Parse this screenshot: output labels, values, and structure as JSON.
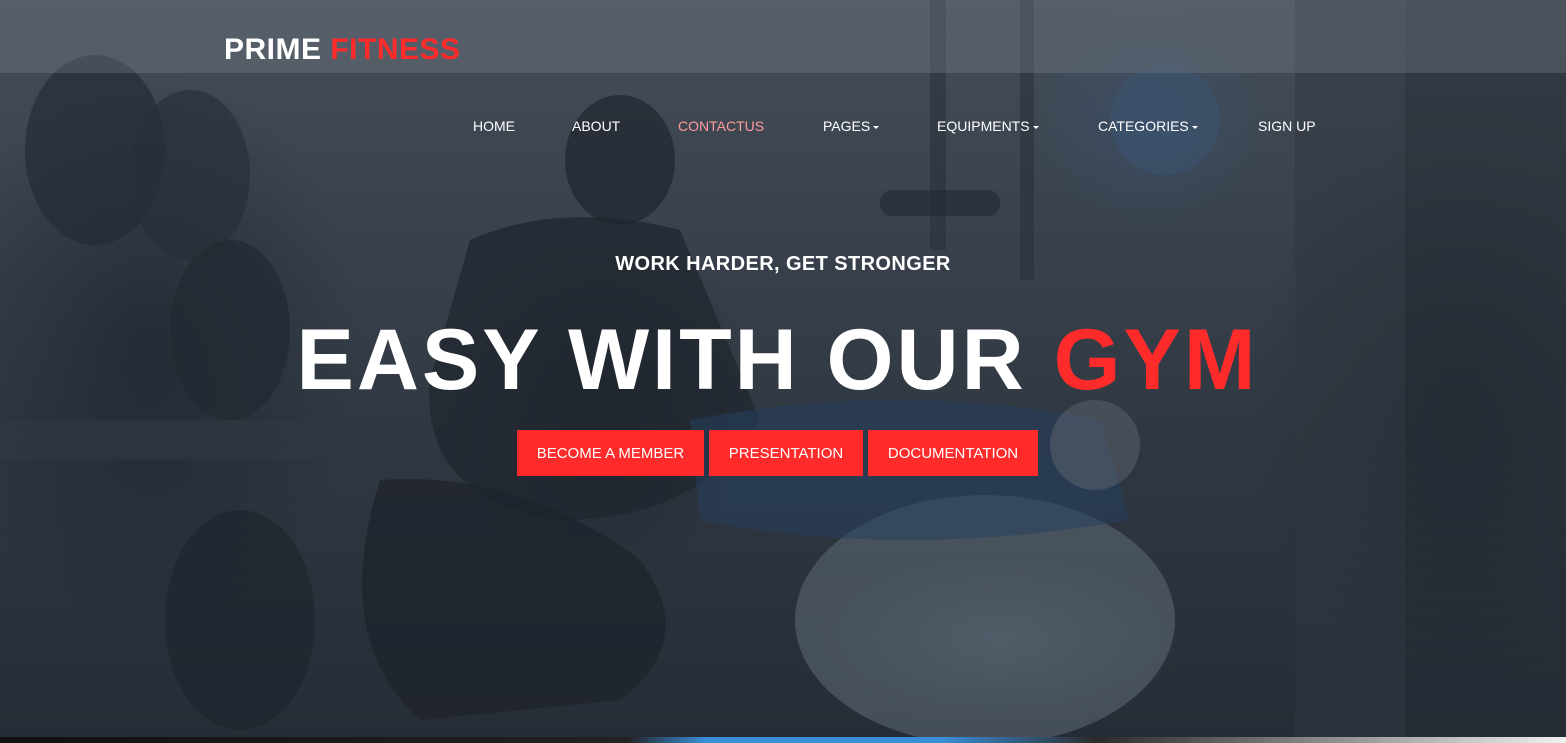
{
  "brand": {
    "name_part1": "PRIME",
    "name_part2": "FITNESS",
    "accent_color": "#ff2b2b"
  },
  "nav": {
    "items": [
      {
        "label": "HOME",
        "active": false,
        "dropdown": false
      },
      {
        "label": "ABOUT",
        "active": false,
        "dropdown": false
      },
      {
        "label": "CONTACTUS",
        "active": true,
        "dropdown": false
      },
      {
        "label": "PAGES",
        "active": false,
        "dropdown": true
      },
      {
        "label": "EQUIPMENTS",
        "active": false,
        "dropdown": true
      },
      {
        "label": "CATEGORIES",
        "active": false,
        "dropdown": true
      },
      {
        "label": "SIGN UP",
        "active": false,
        "dropdown": false
      }
    ],
    "active_color": "#ff9c9c"
  },
  "hero": {
    "subtitle": "WORK HARDER, GET STRONGER",
    "headline_main": "EASY WITH OUR",
    "headline_accent": "GYM",
    "buttons": [
      {
        "label": "BECOME A MEMBER"
      },
      {
        "label": "PRESENTATION"
      },
      {
        "label": "DOCUMENTATION"
      }
    ],
    "button_color": "#ff2a2a",
    "background_image": "gym-workout-photo"
  }
}
